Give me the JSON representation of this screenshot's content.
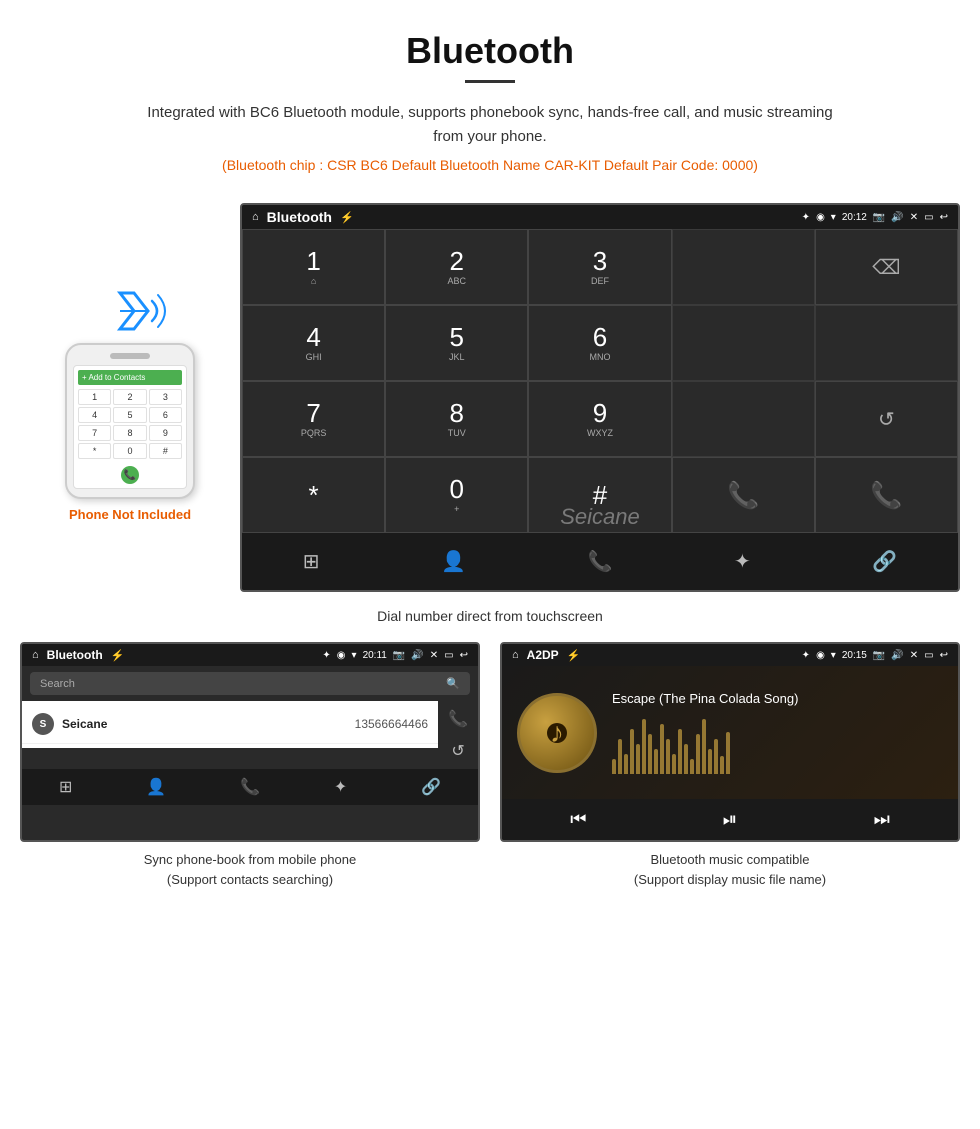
{
  "page": {
    "title": "Bluetooth",
    "description": "Integrated with BC6 Bluetooth module, supports phonebook sync, hands-free call, and music streaming from your phone.",
    "specs": "(Bluetooth chip : CSR BC6    Default Bluetooth Name CAR-KIT    Default Pair Code: 0000)",
    "dial_caption": "Dial number direct from touchscreen",
    "phonebook_caption": "Sync phone-book from mobile phone\n(Support contacts searching)",
    "music_caption": "Bluetooth music compatible\n(Support display music file name)",
    "phone_not_included": "Phone Not Included",
    "watermark": "Seicane"
  },
  "dial_screen": {
    "status_bar": {
      "title": "Bluetooth",
      "time": "20:12",
      "icons": [
        "home",
        "usb",
        "bluetooth",
        "location",
        "signal",
        "battery",
        "camera",
        "volume",
        "close",
        "screen",
        "back"
      ]
    },
    "keys": [
      {
        "digit": "1",
        "sub": "⌂"
      },
      {
        "digit": "2",
        "sub": "ABC"
      },
      {
        "digit": "3",
        "sub": "DEF"
      },
      {
        "digit": "",
        "sub": ""
      },
      {
        "digit": "⌫",
        "sub": ""
      },
      {
        "digit": "4",
        "sub": "GHI"
      },
      {
        "digit": "5",
        "sub": "JKL"
      },
      {
        "digit": "6",
        "sub": "MNO"
      },
      {
        "digit": "",
        "sub": ""
      },
      {
        "digit": "",
        "sub": ""
      },
      {
        "digit": "7",
        "sub": "PQRS"
      },
      {
        "digit": "8",
        "sub": "TUV"
      },
      {
        "digit": "9",
        "sub": "WXYZ"
      },
      {
        "digit": "",
        "sub": ""
      },
      {
        "digit": "↺",
        "sub": ""
      },
      {
        "digit": "*",
        "sub": ""
      },
      {
        "digit": "0",
        "sub": "+"
      },
      {
        "digit": "#",
        "sub": ""
      },
      {
        "digit": "📞",
        "sub": ""
      },
      {
        "digit": "📞",
        "sub": "end"
      }
    ],
    "bottom_nav": [
      "grid",
      "person",
      "phone",
      "bluetooth",
      "link"
    ]
  },
  "phonebook_screen": {
    "status_bar": {
      "title": "Bluetooth",
      "time": "20:11"
    },
    "search_placeholder": "Search",
    "contacts": [
      {
        "initial": "S",
        "name": "Seicane",
        "number": "13566664466"
      }
    ],
    "bottom_nav": [
      "grid",
      "person",
      "phone",
      "bluetooth",
      "link"
    ]
  },
  "music_screen": {
    "status_bar": {
      "title": "A2DP",
      "time": "20:15"
    },
    "song_title": "Escape (The Pina Colada Song)",
    "controls": [
      "prev",
      "play-pause",
      "next"
    ]
  }
}
